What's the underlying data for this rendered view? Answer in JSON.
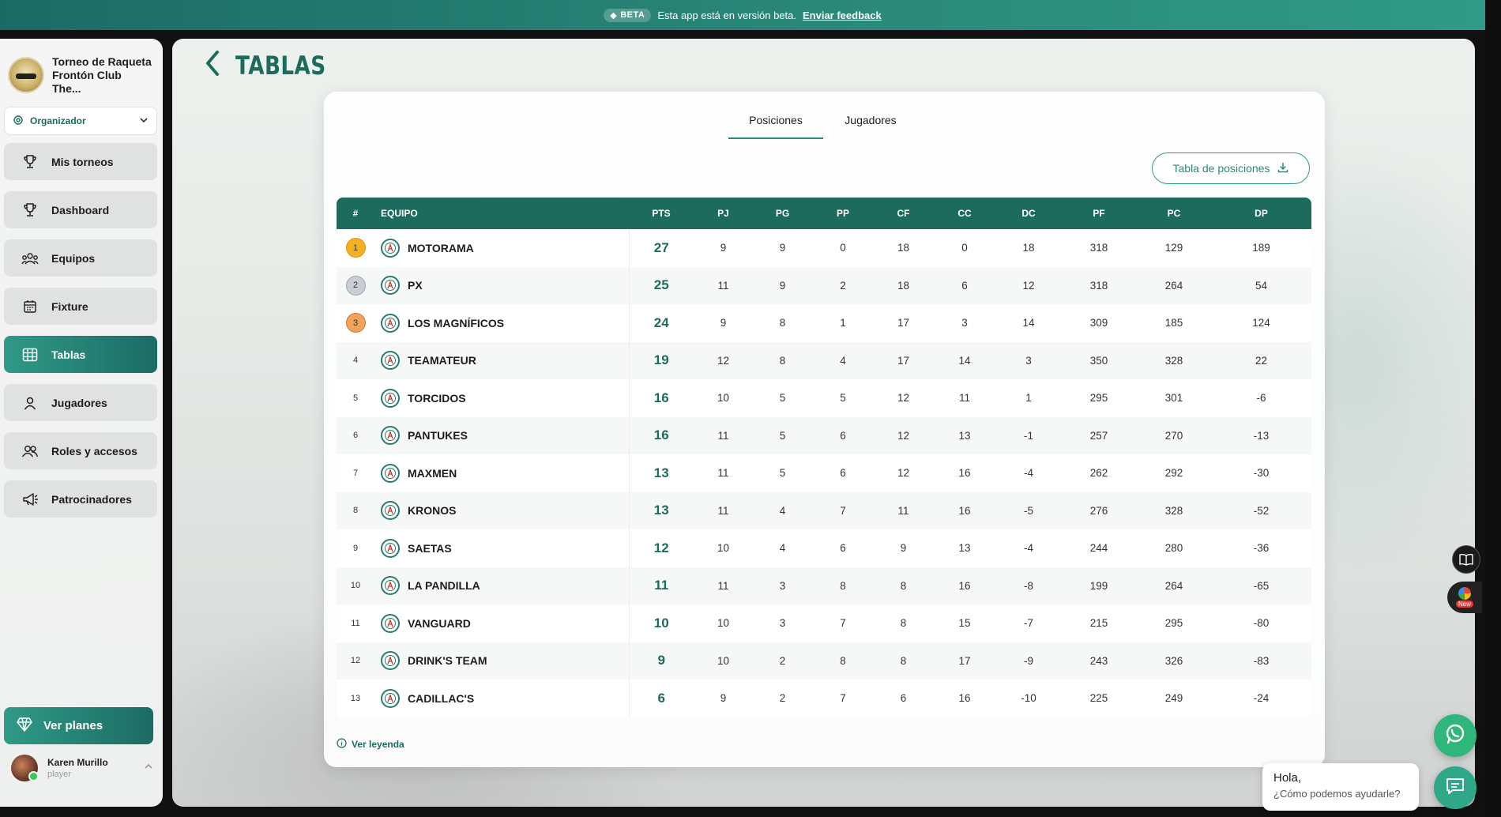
{
  "beta_bar": {
    "badge": "BETA",
    "message": "Esta app está en versión beta.",
    "link": "Enviar feedback"
  },
  "sidebar": {
    "org_name": "Torneo de Raqueta Frontón Club The...",
    "role": "Organizador",
    "items": [
      {
        "label": "Mis torneos",
        "icon": "trophy-icon",
        "active": false
      },
      {
        "label": "Dashboard",
        "icon": "trophy-icon",
        "active": false
      },
      {
        "label": "Equipos",
        "icon": "team-icon",
        "active": false
      },
      {
        "label": "Fixture",
        "icon": "calendar-icon",
        "active": false
      },
      {
        "label": "Tablas",
        "icon": "table-icon",
        "active": true
      },
      {
        "label": "Jugadores",
        "icon": "user-icon",
        "active": false
      },
      {
        "label": "Roles y accesos",
        "icon": "users-icon",
        "active": false
      },
      {
        "label": "Patrocinadores",
        "icon": "megaphone-icon",
        "active": false
      }
    ],
    "plans_label": "Ver planes",
    "user": {
      "name": "Karen Murillo",
      "role": "player"
    }
  },
  "main": {
    "title": "TABLAS",
    "tabs": [
      {
        "label": "Posiciones",
        "active": true
      },
      {
        "label": "Jugadores",
        "active": false
      }
    ],
    "export_label": "Tabla de posiciones",
    "legend_label": "Ver leyenda",
    "table": {
      "columns": [
        "#",
        "EQUIPO",
        "PTS",
        "PJ",
        "PG",
        "PP",
        "CF",
        "CC",
        "DC",
        "PF",
        "PC",
        "DP"
      ],
      "rows": [
        {
          "pos": "1",
          "team": "MOTORAMA",
          "pts": "27",
          "pj": "9",
          "pg": "9",
          "pp": "0",
          "cf": "18",
          "cc": "0",
          "dc": "18",
          "pf": "318",
          "pc": "129",
          "dp": "189"
        },
        {
          "pos": "2",
          "team": "PX",
          "pts": "25",
          "pj": "11",
          "pg": "9",
          "pp": "2",
          "cf": "18",
          "cc": "6",
          "dc": "12",
          "pf": "318",
          "pc": "264",
          "dp": "54"
        },
        {
          "pos": "3",
          "team": "LOS MAGNÍFICOS",
          "pts": "24",
          "pj": "9",
          "pg": "8",
          "pp": "1",
          "cf": "17",
          "cc": "3",
          "dc": "14",
          "pf": "309",
          "pc": "185",
          "dp": "124"
        },
        {
          "pos": "4",
          "team": "TEAMATEUR",
          "pts": "19",
          "pj": "12",
          "pg": "8",
          "pp": "4",
          "cf": "17",
          "cc": "14",
          "dc": "3",
          "pf": "350",
          "pc": "328",
          "dp": "22"
        },
        {
          "pos": "5",
          "team": "TORCIDOS",
          "pts": "16",
          "pj": "10",
          "pg": "5",
          "pp": "5",
          "cf": "12",
          "cc": "11",
          "dc": "1",
          "pf": "295",
          "pc": "301",
          "dp": "-6"
        },
        {
          "pos": "6",
          "team": "PANTUKES",
          "pts": "16",
          "pj": "11",
          "pg": "5",
          "pp": "6",
          "cf": "12",
          "cc": "13",
          "dc": "-1",
          "pf": "257",
          "pc": "270",
          "dp": "-13"
        },
        {
          "pos": "7",
          "team": "MAXMEN",
          "pts": "13",
          "pj": "11",
          "pg": "5",
          "pp": "6",
          "cf": "12",
          "cc": "16",
          "dc": "-4",
          "pf": "262",
          "pc": "292",
          "dp": "-30"
        },
        {
          "pos": "8",
          "team": "KRONOS",
          "pts": "13",
          "pj": "11",
          "pg": "4",
          "pp": "7",
          "cf": "11",
          "cc": "16",
          "dc": "-5",
          "pf": "276",
          "pc": "328",
          "dp": "-52"
        },
        {
          "pos": "9",
          "team": "SAETAS",
          "pts": "12",
          "pj": "10",
          "pg": "4",
          "pp": "6",
          "cf": "9",
          "cc": "13",
          "dc": "-4",
          "pf": "244",
          "pc": "280",
          "dp": "-36"
        },
        {
          "pos": "10",
          "team": "LA PANDILLA",
          "pts": "11",
          "pj": "11",
          "pg": "3",
          "pp": "8",
          "cf": "8",
          "cc": "16",
          "dc": "-8",
          "pf": "199",
          "pc": "264",
          "dp": "-65"
        },
        {
          "pos": "11",
          "team": "VANGUARD",
          "pts": "10",
          "pj": "10",
          "pg": "3",
          "pp": "7",
          "cf": "8",
          "cc": "15",
          "dc": "-7",
          "pf": "215",
          "pc": "295",
          "dp": "-80"
        },
        {
          "pos": "12",
          "team": "DRINK'S TEAM",
          "pts": "9",
          "pj": "10",
          "pg": "2",
          "pp": "8",
          "cf": "8",
          "cc": "17",
          "dc": "-9",
          "pf": "243",
          "pc": "326",
          "dp": "-83"
        },
        {
          "pos": "13",
          "team": "CADILLAC'S",
          "pts": "6",
          "pj": "9",
          "pg": "2",
          "pp": "7",
          "cf": "6",
          "cc": "16",
          "dc": "-10",
          "pf": "225",
          "pc": "249",
          "dp": "-24"
        }
      ]
    }
  },
  "chat": {
    "greeting": "Hola,",
    "question": "¿Cómo podemos ayudarle?",
    "ext_badge": "New"
  },
  "colors": {
    "brand": "#1c6b5d",
    "accent": "#2f9a86",
    "gold": "#f5b021",
    "silver": "#c9ced6",
    "bronze": "#f0a35a"
  }
}
